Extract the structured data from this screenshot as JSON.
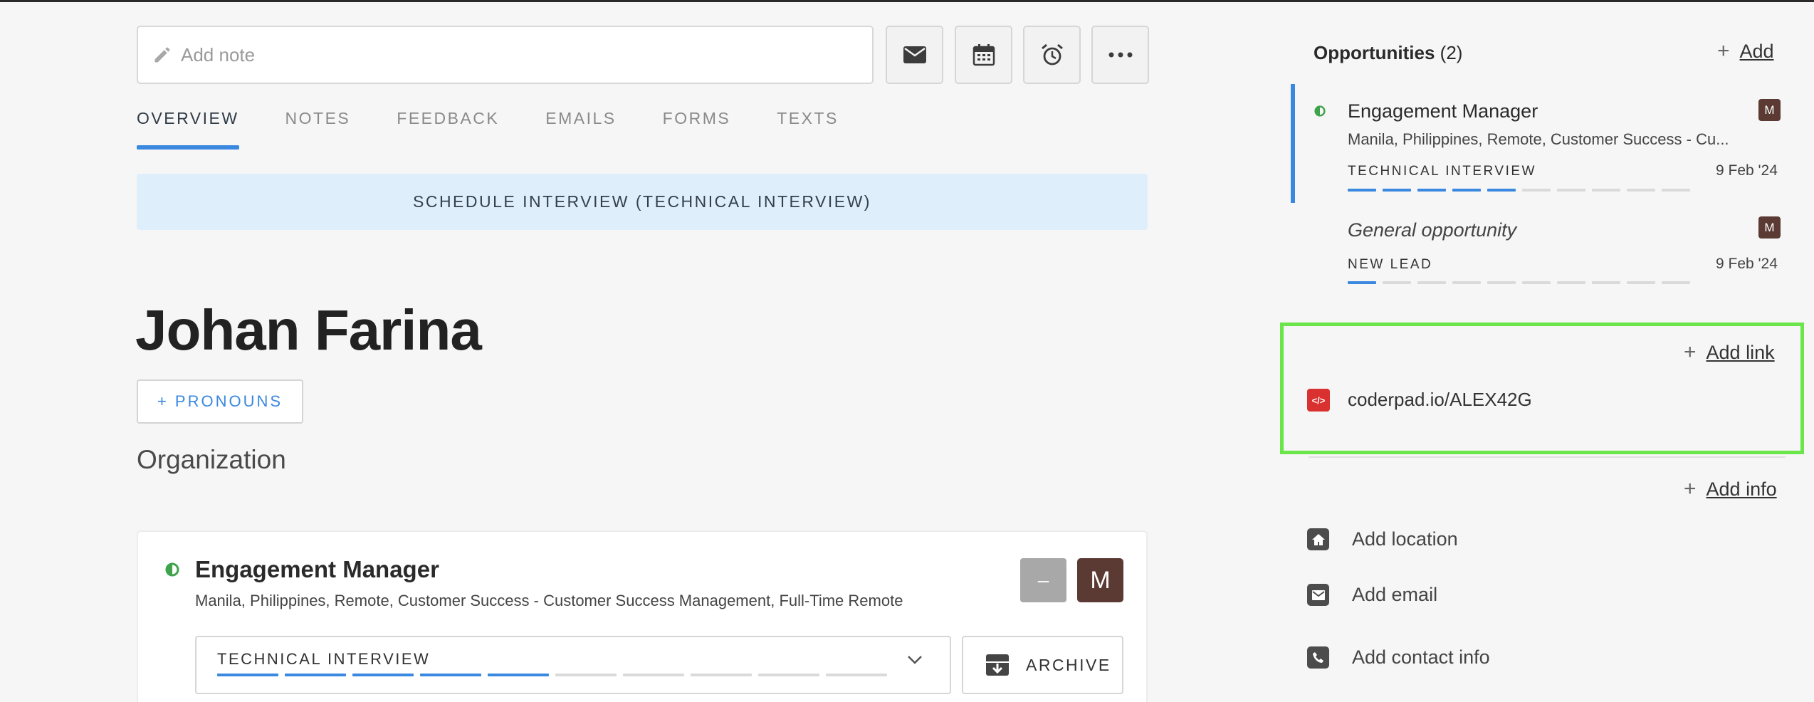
{
  "note": {
    "placeholder": "Add note"
  },
  "toolbar": {
    "email_icon": "envelope-icon",
    "calendar_icon": "calendar-icon",
    "alarm_icon": "alarm-clock-icon",
    "more_icon": "more-horizontal-icon"
  },
  "tabs": [
    {
      "label": "OVERVIEW",
      "active": true
    },
    {
      "label": "NOTES"
    },
    {
      "label": "FEEDBACK"
    },
    {
      "label": "EMAILS"
    },
    {
      "label": "FORMS"
    },
    {
      "label": "TEXTS"
    }
  ],
  "banner": {
    "label": "SCHEDULE INTERVIEW (TECHNICAL INTERVIEW)"
  },
  "candidate": {
    "name": "Johan Farina",
    "pronouns_button": "+ PRONOUNS",
    "organization_label": "Organization"
  },
  "main_opportunity": {
    "title": "Engagement Manager",
    "subtitle": "Manila, Philippines, Remote, Customer Success - Customer Success Management, Full-Time Remote",
    "stage": "TECHNICAL INTERVIEW",
    "stage_progress": {
      "completed": 5,
      "total": 10
    },
    "dash_button": "–",
    "avatar": "M",
    "archive_label": "ARCHIVE"
  },
  "opportunities_panel": {
    "heading": "Opportunities",
    "count": "(2)",
    "add_label": "Add",
    "items": [
      {
        "title": "Engagement Manager",
        "subtitle": "Manila, Philippines, Remote, Customer Success - Cu...",
        "stage": "TECHNICAL INTERVIEW",
        "date": "9 Feb '24",
        "avatar": "M",
        "progress": {
          "completed": 5,
          "total": 10
        }
      },
      {
        "title": "General opportunity",
        "stage": "NEW LEAD",
        "date": "9 Feb '24",
        "avatar": "M",
        "progress": {
          "completed": 1,
          "total": 10
        }
      }
    ]
  },
  "links": {
    "add_label": "Add link",
    "items": [
      {
        "text": "coderpad.io/ALEX42G",
        "icon": "code-icon"
      }
    ]
  },
  "info": {
    "add_label": "Add info",
    "rows": [
      {
        "label": "Add location",
        "icon": "home-icon"
      },
      {
        "label": "Add email",
        "icon": "envelope-icon"
      },
      {
        "label": "Add contact info",
        "icon": "phone-icon"
      }
    ]
  },
  "colors": {
    "accent": "#3a88e0",
    "highlight": "#6ae64a",
    "avatar_bg": "#5a3a33",
    "banner_bg": "#dfeefb",
    "code_icon_bg": "#d8312f"
  }
}
